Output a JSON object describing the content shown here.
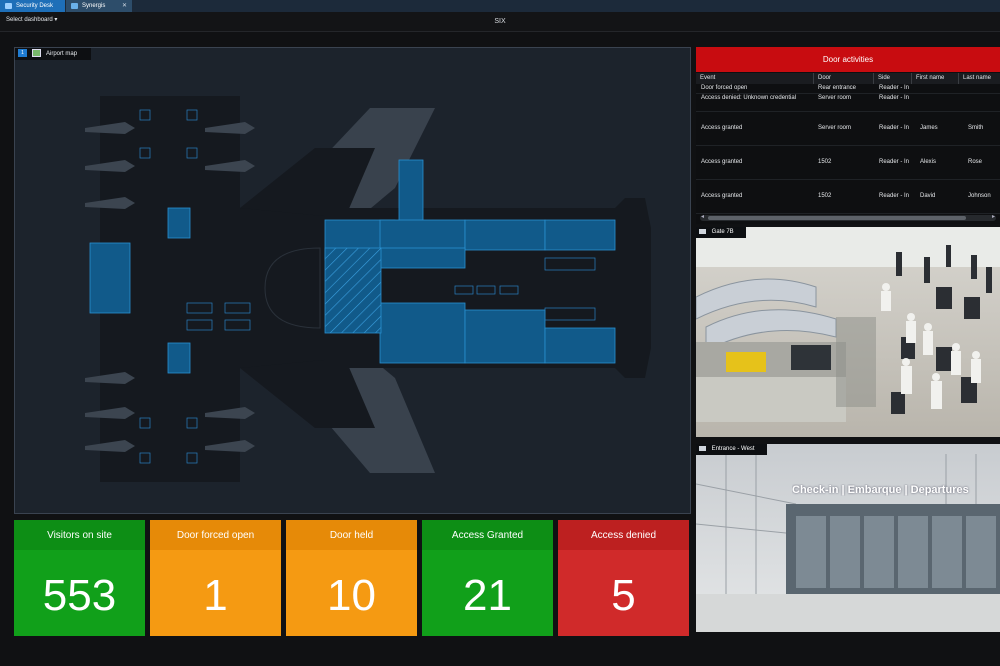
{
  "tabs": [
    {
      "label": "Security Desk"
    },
    {
      "label": "Synergis"
    }
  ],
  "toolbar": {
    "select_dashboard": "Select dashboard",
    "dashboard_title": "SIX"
  },
  "map": {
    "badge": "1",
    "title": "Airport map"
  },
  "door_activities": {
    "title": "Door activities",
    "columns": [
      "Event",
      "Door",
      "Side",
      "First name",
      "Last name"
    ],
    "rows": [
      {
        "event": "Door forced open",
        "door": "Rear entrance",
        "side": "Reader - In",
        "first": "",
        "last": ""
      },
      {
        "event": "Access denied: Unknown credential",
        "door": "Server room",
        "side": "Reader - In",
        "first": "",
        "last": ""
      },
      {
        "event": "Access granted",
        "door": "Server room",
        "side": "Reader - In",
        "first": "James",
        "last": "Smith"
      },
      {
        "event": "Access granted",
        "door": "1502",
        "side": "Reader - In",
        "first": "Alexis",
        "last": "Rose"
      },
      {
        "event": "Access granted",
        "door": "1502",
        "side": "Reader - In",
        "first": "David",
        "last": "Johnson"
      }
    ]
  },
  "cameras": [
    {
      "title": "Gate 7B"
    },
    {
      "title": "Entrance - West",
      "sign": "Check-in | Embarque | Departures"
    }
  ],
  "tiles": [
    {
      "label": "Visitors on site",
      "value": "553",
      "color": "#11a01a"
    },
    {
      "label": "Door forced open",
      "value": "1",
      "color": "#f59a12"
    },
    {
      "label": "Door held",
      "value": "10",
      "color": "#f59a12"
    },
    {
      "label": "Access Granted",
      "value": "21",
      "color": "#11a01a"
    },
    {
      "label": "Access denied",
      "value": "5",
      "color": "#d02a2a"
    }
  ]
}
